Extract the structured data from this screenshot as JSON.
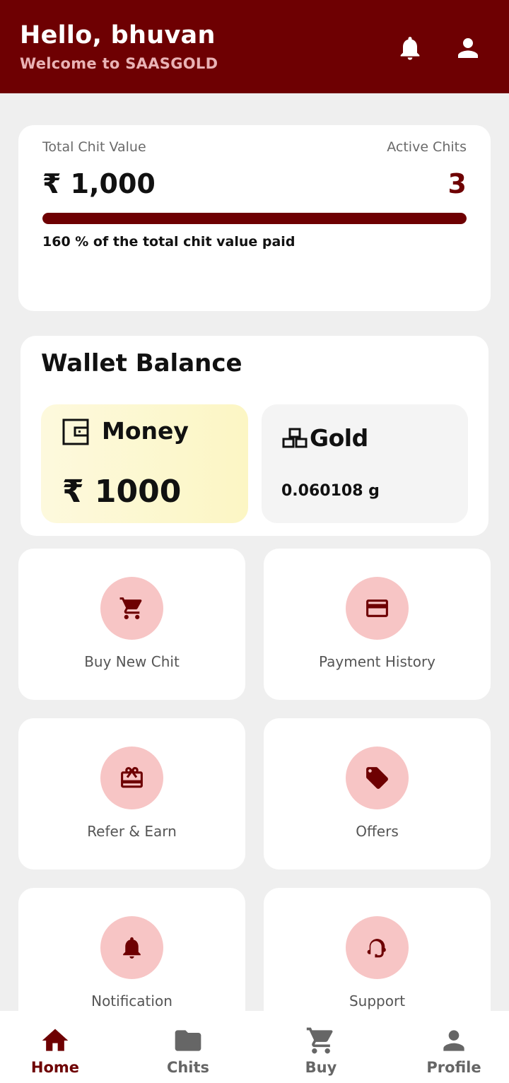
{
  "header": {
    "greeting": "Hello, bhuvan",
    "subtitle": "Welcome to SAASGOLD",
    "bell_icon": "bell-icon",
    "profile_icon": "person-icon"
  },
  "summary": {
    "total_label": "Total Chit Value",
    "total_value": "₹ 1,000",
    "active_label": "Active Chits",
    "active_value": "3",
    "progress_fraction": 1.0,
    "paid_text": "160 % of the total chit value paid"
  },
  "wallet": {
    "title": "Wallet Balance",
    "money_label": "Money",
    "money_value": "₹ 1000",
    "gold_label": "Gold",
    "gold_value": "0.060108 g"
  },
  "actions": [
    {
      "label": "Buy New Chit",
      "icon": "cart-icon"
    },
    {
      "label": "Payment History",
      "icon": "card-icon"
    },
    {
      "label": "Refer & Earn",
      "icon": "gift-card-icon"
    },
    {
      "label": "Offers",
      "icon": "tag-icon"
    },
    {
      "label": "Notification",
      "icon": "bell-icon"
    },
    {
      "label": "Support",
      "icon": "headset-icon"
    }
  ],
  "nav": [
    {
      "label": "Home",
      "icon": "home-icon",
      "active": true
    },
    {
      "label": "Chits",
      "icon": "folder-icon",
      "active": false
    },
    {
      "label": "Buy",
      "icon": "cart-icon",
      "active": false
    },
    {
      "label": "Profile",
      "icon": "person-icon",
      "active": false
    }
  ],
  "colors": {
    "primary": "#6e0002",
    "accent_circle": "#f7c5c5",
    "nav_inactive": "#666666"
  }
}
